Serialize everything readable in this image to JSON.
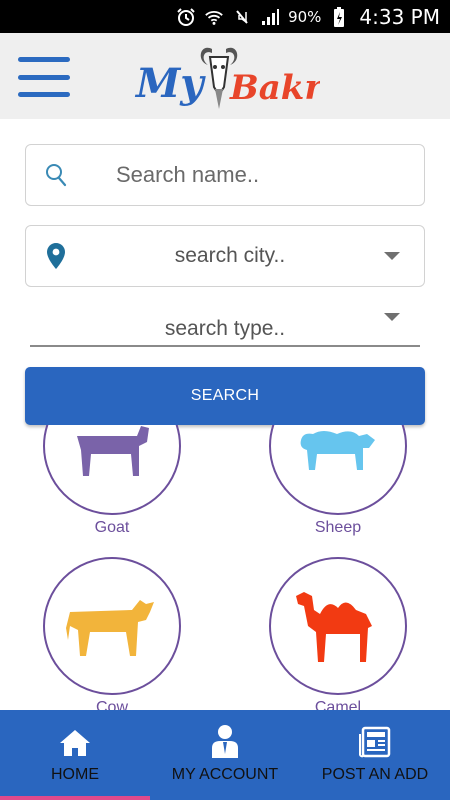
{
  "status_bar": {
    "battery": "90%",
    "time": "4:33 PM"
  },
  "app": {
    "logo_text": "MyBakra",
    "accent": "#2a66bf"
  },
  "search": {
    "name_placeholder": "Search name..",
    "city_value": "search city..",
    "type_value": "search type..",
    "button_label": "SEARCH"
  },
  "animals": [
    {
      "label": "Goat",
      "color": "#7a63a9"
    },
    {
      "label": "Sheep",
      "color": "#66c5ee"
    },
    {
      "label": "Cow",
      "color": "#f2b43b"
    },
    {
      "label": "Camel",
      "color": "#f23a12"
    }
  ],
  "bottom_nav": [
    {
      "label": "HOME",
      "icon": "home-icon",
      "active": true
    },
    {
      "label": "MY ACCOUNT",
      "icon": "account-icon",
      "active": false
    },
    {
      "label": "POST AN ADD",
      "icon": "newspaper-icon",
      "active": false
    }
  ]
}
